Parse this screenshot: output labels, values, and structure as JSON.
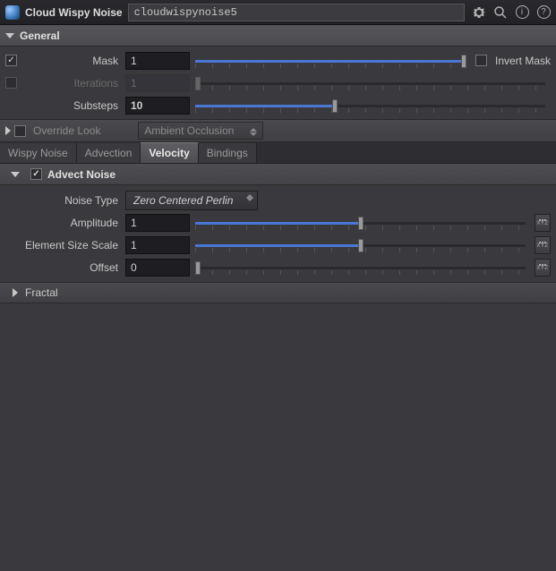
{
  "titlebar": {
    "node_type": "Cloud Wispy Noise",
    "node_name": "cloudwispynoise5"
  },
  "general": {
    "header": "General",
    "mask": {
      "label": "Mask",
      "value": "1",
      "enabled": true,
      "slider_pct": 100
    },
    "invert_mask": {
      "label": "Invert Mask",
      "checked": false
    },
    "iterations": {
      "label": "Iterations",
      "value": "1",
      "enabled": false,
      "slider_pct": 0
    },
    "substeps": {
      "label": "Substeps",
      "value": "10",
      "slider_pct": 40
    },
    "override_look": {
      "label": "Override Look",
      "checked": false,
      "selected": "Ambient Occlusion"
    }
  },
  "tabs": [
    "Wispy Noise",
    "Advection",
    "Velocity",
    "Bindings"
  ],
  "active_tab": 2,
  "advect": {
    "header": "Advect Noise",
    "checked": true,
    "noise_type": {
      "label": "Noise Type",
      "selected": "Zero Centered Perlin"
    },
    "amplitude": {
      "label": "Amplitude",
      "value": "1",
      "slider_pct": 50
    },
    "element_size_scale": {
      "label": "Element Size Scale",
      "value": "1",
      "slider_pct": 50
    },
    "offset": {
      "label": "Offset",
      "value": "0",
      "slider_pct": 0
    }
  },
  "fractal": {
    "label": "Fractal"
  }
}
